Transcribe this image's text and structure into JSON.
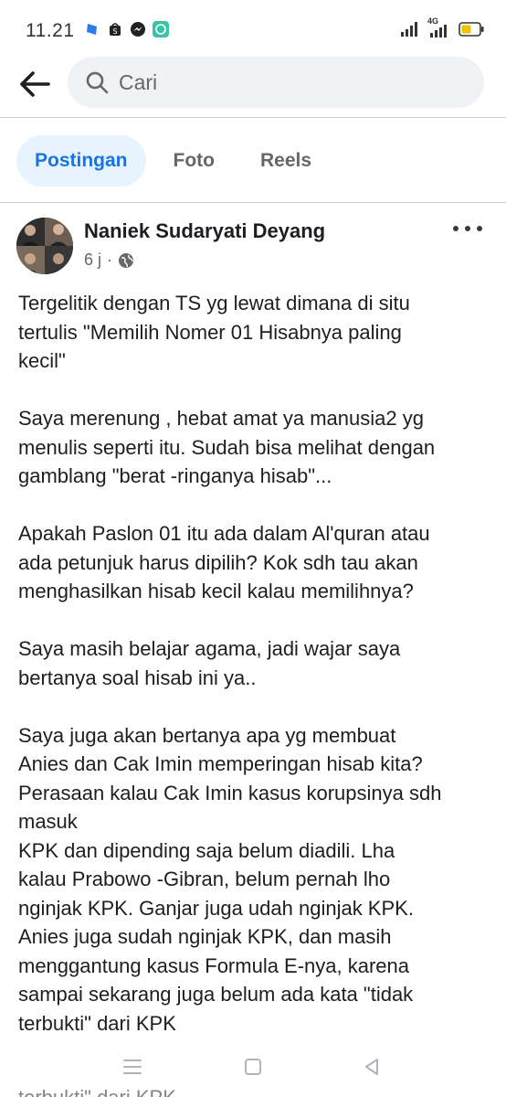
{
  "status_bar": {
    "time": "11.21",
    "network": "4G"
  },
  "search": {
    "placeholder": "Cari"
  },
  "tabs": [
    {
      "label": "Postingan",
      "active": true
    },
    {
      "label": "Foto",
      "active": false
    },
    {
      "label": "Reels",
      "active": false
    }
  ],
  "post": {
    "author": "Naniek Sudaryati Deyang",
    "time_ago": "6 j",
    "separator": "·",
    "privacy_icon": "globe-icon",
    "paragraphs": [
      [
        "Tergelitik dengan TS yg lewat dimana di situ",
        "tertulis \"Memilih Nomer 01 Hisabnya  paling",
        "kecil\""
      ],
      [
        "Saya merenung , hebat amat ya manusia2 yg",
        "menulis seperti itu. Sudah bisa melihat dengan",
        "gamblang \"berat -ringanya hisab\"..."
      ],
      [
        "Apakah Paslon 01 itu ada dalam Al'quran atau",
        "ada petunjuk harus dipilih? Kok sdh tau akan",
        "menghasilkan hisab kecil kalau memilihnya?"
      ],
      [
        "Saya masih belajar agama, jadi wajar saya",
        "bertanya soal hisab ini ya.."
      ],
      [
        "Saya juga akan bertanya apa yg membuat",
        "Anies dan Cak Imin memperingan hisab kita?",
        "Perasaan kalau Cak Imin kasus korupsinya sdh",
        "masuk",
        "KPK dan dipending saja belum diadili. Lha",
        "kalau Prabowo -Gibran, belum pernah lho",
        "nginjak KPK. Ganjar juga udah nginjak KPK.",
        "Anies  juga sudah nginjak KPK, dan masih",
        "menggantung kasus  Formula E-nya, karena",
        "sampai sekarang juga belum ada kata \"tidak",
        "terbukti\" dari KPK"
      ]
    ],
    "peek_text": "terbukti\" dari KPK"
  },
  "colors": {
    "accent": "#1b74e4",
    "tab_active_bg": "#e7f3ff",
    "search_bg": "#f0f2f5",
    "secondary_text": "#65676b"
  }
}
